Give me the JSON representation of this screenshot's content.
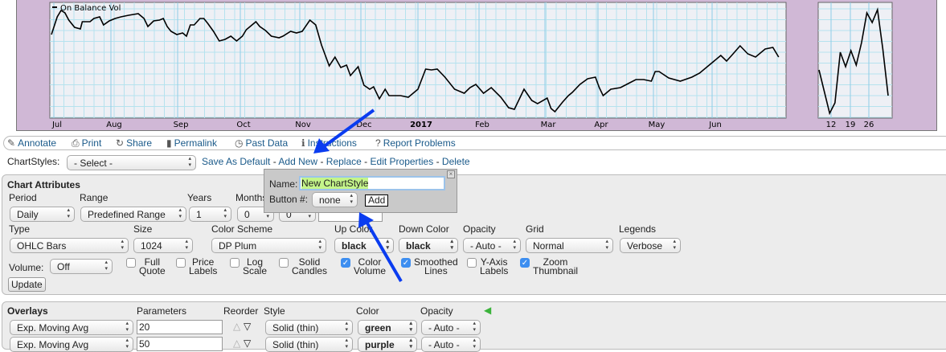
{
  "chart": {
    "legend": "On Balance Vol",
    "months": [
      "Jul",
      "Aug",
      "Sep",
      "Oct",
      "Nov",
      "Dec",
      "2017",
      "Feb",
      "Mar",
      "Apr",
      "May",
      "Jun"
    ],
    "obv_series": [
      [
        0,
        104
      ],
      [
        3,
        126
      ],
      [
        5,
        134
      ],
      [
        7,
        131
      ],
      [
        9,
        122
      ],
      [
        12,
        113
      ],
      [
        15,
        111
      ],
      [
        16,
        120
      ],
      [
        20,
        120
      ],
      [
        22,
        124
      ],
      [
        25,
        126
      ],
      [
        27,
        116
      ],
      [
        30,
        121
      ],
      [
        33,
        124
      ],
      [
        36,
        126
      ],
      [
        40,
        128
      ],
      [
        45,
        130
      ],
      [
        48,
        124
      ],
      [
        50,
        114
      ],
      [
        53,
        121
      ],
      [
        56,
        122
      ],
      [
        58,
        124
      ],
      [
        60,
        114
      ],
      [
        62,
        108
      ],
      [
        65,
        104
      ],
      [
        68,
        106
      ],
      [
        70,
        102
      ],
      [
        72,
        116
      ],
      [
        74,
        116
      ],
      [
        77,
        124
      ],
      [
        79,
        124
      ],
      [
        81,
        118
      ],
      [
        84,
        108
      ],
      [
        87,
        96
      ],
      [
        90,
        98
      ],
      [
        93,
        102
      ],
      [
        96,
        96
      ],
      [
        99,
        102
      ],
      [
        101,
        110
      ],
      [
        104,
        116
      ],
      [
        106,
        120
      ],
      [
        108,
        114
      ],
      [
        111,
        109
      ],
      [
        114,
        102
      ],
      [
        118,
        100
      ],
      [
        120,
        102
      ],
      [
        124,
        108
      ],
      [
        127,
        106
      ],
      [
        130,
        108
      ],
      [
        134,
        122
      ],
      [
        137,
        116
      ],
      [
        140,
        91
      ],
      [
        144,
        65
      ],
      [
        147,
        76
      ],
      [
        150,
        63
      ],
      [
        153,
        66
      ],
      [
        155,
        53
      ],
      [
        159,
        64
      ],
      [
        162,
        41
      ],
      [
        165,
        36
      ],
      [
        167,
        39
      ],
      [
        170,
        24
      ],
      [
        173,
        36
      ],
      [
        175,
        28
      ],
      [
        181,
        28
      ],
      [
        185,
        26
      ],
      [
        190,
        36
      ],
      [
        194,
        61
      ],
      [
        197,
        60
      ],
      [
        200,
        61
      ],
      [
        204,
        51
      ],
      [
        209,
        36
      ],
      [
        214,
        31
      ],
      [
        217,
        38
      ],
      [
        220,
        42
      ],
      [
        224,
        31
      ],
      [
        228,
        38
      ],
      [
        233,
        26
      ],
      [
        237,
        13
      ],
      [
        240,
        11
      ],
      [
        245,
        36
      ],
      [
        249,
        22
      ],
      [
        252,
        18
      ],
      [
        257,
        25
      ],
      [
        259,
        12
      ],
      [
        261,
        8
      ],
      [
        265,
        20
      ],
      [
        268,
        28
      ],
      [
        270,
        32
      ],
      [
        274,
        42
      ],
      [
        278,
        49
      ],
      [
        282,
        51
      ],
      [
        284,
        38
      ],
      [
        286,
        28
      ],
      [
        290,
        36
      ],
      [
        295,
        38
      ],
      [
        299,
        43
      ],
      [
        303,
        48
      ],
      [
        307,
        48
      ],
      [
        311,
        46
      ],
      [
        313,
        58
      ],
      [
        315,
        58
      ],
      [
        320,
        50
      ],
      [
        326,
        46
      ],
      [
        332,
        51
      ],
      [
        336,
        56
      ],
      [
        342,
        68
      ],
      [
        347,
        78
      ],
      [
        350,
        71
      ],
      [
        353,
        79
      ],
      [
        357,
        90
      ],
      [
        361,
        80
      ],
      [
        365,
        76
      ],
      [
        370,
        86
      ],
      [
        374,
        88
      ],
      [
        377,
        76
      ]
    ],
    "thumb_labels": [
      "12",
      "19",
      "26"
    ],
    "thumb_series": [
      60,
      33,
      6,
      19,
      82,
      64,
      84,
      66,
      94,
      131,
      119,
      135,
      86,
      28
    ]
  },
  "toolbar": [
    {
      "icon": "pencil-icon",
      "glyph": "✎",
      "label": "Annotate"
    },
    {
      "icon": "printer-icon",
      "glyph": "⎙",
      "label": "Print"
    },
    {
      "icon": "share-icon",
      "glyph": "↻",
      "label": "Share"
    },
    {
      "icon": "bookmark-icon",
      "glyph": "▮",
      "label": "Permalink"
    },
    {
      "icon": "clock-icon",
      "glyph": "◷",
      "label": "Past Data"
    },
    {
      "icon": "info-icon",
      "glyph": "ℹ",
      "label": "Instructions"
    },
    {
      "icon": "question-icon",
      "glyph": "?",
      "label": "Report Problems"
    }
  ],
  "chartstyles": {
    "label": "ChartStyles:",
    "selected": "- Select -",
    "save_default": "Save As Default",
    "add_new": "Add New",
    "replace": "Replace",
    "edit": "Edit Properties",
    "delete": "Delete",
    "sep": "-"
  },
  "attributes": {
    "title": "Chart Attributes",
    "period_label": "Period",
    "period": "Daily",
    "range_label": "Range",
    "range": "Predefined Range",
    "years_label": "Years",
    "years": "1",
    "months_label": "Months",
    "months": "0",
    "days": "0",
    "type_label": "Type",
    "type": "OHLC Bars",
    "size_label": "Size",
    "size": "1024",
    "scheme_label": "Color Scheme",
    "scheme": "DP Plum",
    "up_label": "Up Color",
    "up": "black",
    "down_label": "Down Color",
    "down": "black",
    "opacity_label": "Opacity",
    "opacity": "- Auto -",
    "grid_label": "Grid",
    "grid": "Normal",
    "legends_label": "Legends",
    "legends": "Verbose",
    "volume_label": "Volume:",
    "volume": "Off",
    "checkboxes": [
      {
        "l1": "Full",
        "l2": "Quote",
        "checked": false
      },
      {
        "l1": "Price",
        "l2": "Labels",
        "checked": false
      },
      {
        "l1": "Log",
        "l2": "Scale",
        "checked": false
      },
      {
        "l1": "Solid",
        "l2": "Candles",
        "checked": false
      },
      {
        "l1": "Color",
        "l2": "Volume",
        "checked": true
      },
      {
        "l1": "Smoothed",
        "l2": "Lines",
        "checked": true
      },
      {
        "l1": "Y-Axis",
        "l2": "Labels",
        "checked": false
      },
      {
        "l1": "Zoom",
        "l2": "Thumbnail",
        "checked": true
      }
    ],
    "update": "Update"
  },
  "overlays": {
    "title": "Overlays",
    "params": "Parameters",
    "reorder": "Reorder",
    "style": "Style",
    "color": "Color",
    "opacity": "Opacity",
    "rows": [
      {
        "type": "Exp. Moving Avg",
        "param": "20",
        "style": "Solid (thin)",
        "color": "green",
        "opacity": "- Auto -"
      },
      {
        "type": "Exp. Moving Avg",
        "param": "50",
        "style": "Solid (thin)",
        "color": "purple",
        "opacity": "- Auto -"
      }
    ]
  },
  "popup": {
    "name_label": "Name:",
    "name_value": "New ChartStyle",
    "button_label": "Button #:",
    "button_value": "none",
    "add": "Add"
  },
  "colors": {
    "arrow": "#0a3cf0",
    "panel": "#d0b8d6",
    "grid": "#a8dcec"
  }
}
